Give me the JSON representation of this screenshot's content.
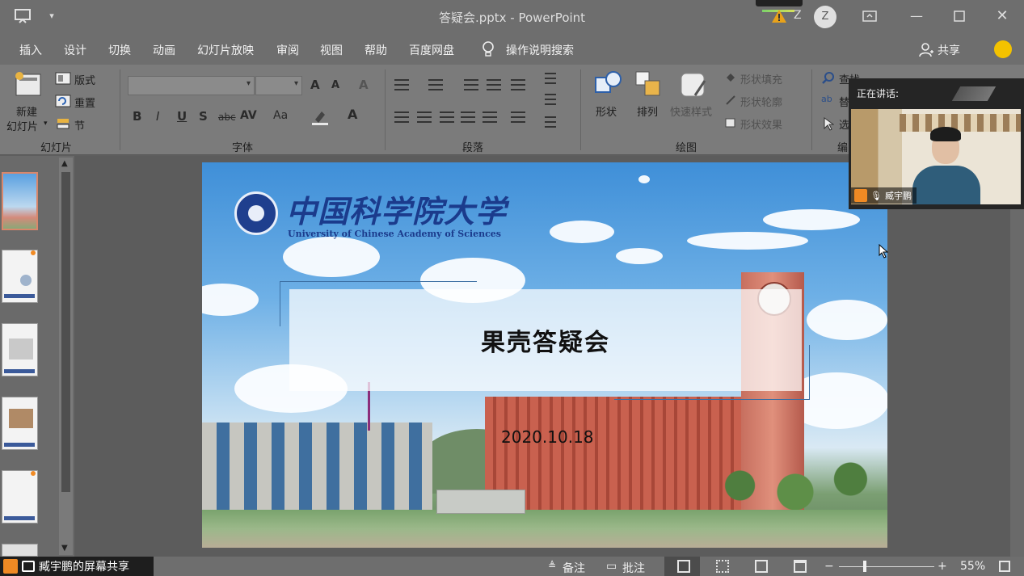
{
  "window": {
    "title": "答疑会.pptx  -  PowerPoint",
    "user_initial": "Z",
    "account_badge": "Z"
  },
  "tabs": [
    "插入",
    "设计",
    "切换",
    "动画",
    "幻灯片放映",
    "审阅",
    "视图",
    "帮助",
    "百度网盘"
  ],
  "tell_me": "操作说明搜索",
  "share_label": "共享",
  "ribbon": {
    "slides": {
      "new_slide_line1": "新建",
      "new_slide_line2": "幻灯片",
      "layout": "版式",
      "reset": "重置",
      "section": "节",
      "group_label": "幻灯片"
    },
    "font": {
      "bold": "B",
      "italic": "I",
      "underline": "U",
      "shadow": "S",
      "strike": "abc",
      "spacing": "AV",
      "case": "Aa",
      "grow": "A",
      "shrink": "A",
      "clear": "A",
      "color": "A",
      "group_label": "字体"
    },
    "paragraph": {
      "group_label": "段落"
    },
    "drawing": {
      "shapes": "形状",
      "arrange": "排列",
      "quick_styles": "快速样式",
      "shape_fill": "形状填充",
      "shape_outline": "形状轮廓",
      "shape_effects": "形状效果",
      "group_label": "绘图"
    },
    "editing": {
      "find": "查找",
      "replace": "替",
      "select": "选",
      "group_label": "编"
    }
  },
  "slide": {
    "logo_cn": "中国科学院大学",
    "logo_en": "University of Chinese Academy of Sciences",
    "title": "果壳答疑会",
    "date": "2020.10.18"
  },
  "video": {
    "speaking_label": "正在讲话:",
    "name": "臧宇鹏"
  },
  "statusbar": {
    "screen_share": "臧宇鹏的屏幕共享",
    "notes": "备注",
    "comments": "批注",
    "zoom": "55%",
    "zoom_minus": "−",
    "zoom_plus": "+"
  },
  "colors": {
    "titlebar": "#6e6e6e",
    "ribbon": "#7b7b7b",
    "accent_orange": "#f08a24",
    "logo_blue": "#1b3b8c"
  }
}
